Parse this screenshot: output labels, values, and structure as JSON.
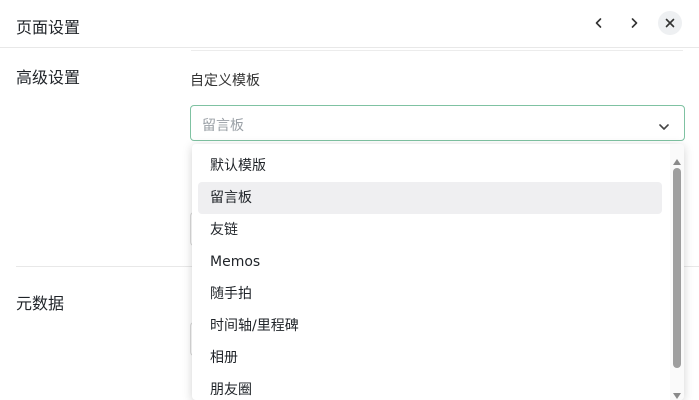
{
  "header": {
    "title": "页面设置"
  },
  "sections": {
    "advanced": "高级设置",
    "metadata": "元数据"
  },
  "template_field": {
    "label": "自定义模板",
    "selected": "留言板"
  },
  "dropdown": {
    "options": [
      "默认模版",
      "留言板",
      "友链",
      "Memos",
      "随手拍",
      "时间轴/里程碑",
      "相册",
      "朋友圈"
    ],
    "active_index": 1
  },
  "colors": {
    "focus_border": "#7fc2a2",
    "hover_bg": "#efeff1"
  },
  "icons": {
    "prev": "chevron-left-icon",
    "next": "chevron-right-icon",
    "close": "close-icon",
    "select": "chevron-down-icon"
  }
}
